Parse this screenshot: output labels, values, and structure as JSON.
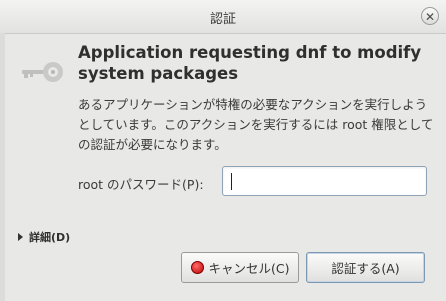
{
  "window": {
    "title": "認証",
    "close_glyph": "✕"
  },
  "dialog": {
    "heading": "Application requesting dnf to modify system packages",
    "description": "あるアプリケーションが特権の必要なアクションを実行しようとしています。このアクションを実行するには root 権限としての認証が必要になります。",
    "password_label": "root のパスワード(P):",
    "password_value": "",
    "details_label": "詳細(D)"
  },
  "buttons": {
    "cancel_label": "キャンセル(C)",
    "authenticate_label": "認証する(A)"
  },
  "icons": {
    "dialog_icon": "key-icon",
    "cancel_icon": "stop-icon",
    "details_icon": "expander-triangle-icon"
  },
  "colors": {
    "window_bg": "#e8e8e7",
    "focus_border": "#8fa3b7",
    "stop_red": "#c00000"
  }
}
